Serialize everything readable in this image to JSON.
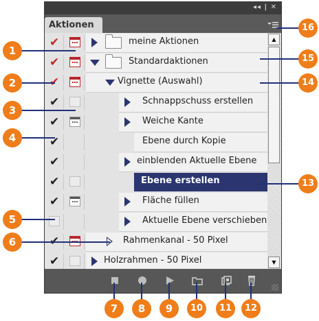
{
  "window": {
    "controls": "◂◂ | ✕",
    "tab_label": "Aktionen",
    "menu_icon": "panel-menu-icon"
  },
  "rows": [
    {
      "check": "red",
      "dialog": "red",
      "label": "meine Aktionen",
      "kind": "set",
      "expanded": false
    },
    {
      "check": "red",
      "dialog": "red",
      "label": "Standardaktionen",
      "kind": "set",
      "expanded": true
    },
    {
      "check": "red",
      "dialog": "red",
      "label": "Vignette (Auswahl)",
      "kind": "action",
      "expanded": true
    },
    {
      "check": "black",
      "dialog": "empty",
      "label": "Schnappschuss erstellen",
      "kind": "command",
      "expanded": false
    },
    {
      "check": "black",
      "dialog": "dark",
      "label": "Weiche Kante",
      "kind": "command",
      "expanded": false
    },
    {
      "check": "black",
      "dialog": "none",
      "label": "Ebene durch Kopie",
      "kind": "command-plain"
    },
    {
      "check": "black",
      "dialog": "none",
      "label": "einblenden Aktuelle Ebene",
      "kind": "command",
      "expanded": false
    },
    {
      "check": "black",
      "dialog": "empty",
      "label": "Ebene erstellen",
      "kind": "command-plain",
      "selected": true
    },
    {
      "check": "black",
      "dialog": "dark",
      "label": "Fläche füllen",
      "kind": "command",
      "expanded": false
    },
    {
      "check": "none",
      "dialog": "none",
      "label": "Aktuelle Ebene verschieben",
      "kind": "command",
      "expanded": false
    },
    {
      "check": "black",
      "dialog": "red",
      "label": "Rahmenkanal - 50 Pixel",
      "kind": "action",
      "expanded": false
    },
    {
      "check": "black",
      "dialog": "empty",
      "label": "Holzrahmen - 50 Pixel",
      "kind": "action",
      "expanded": false
    }
  ],
  "toolbar": [
    "stop-icon",
    "record-icon",
    "play-icon",
    "new-set-icon",
    "new-action-icon",
    "delete-icon"
  ],
  "callouts": [
    "1",
    "2",
    "3",
    "4",
    "5",
    "6",
    "7",
    "8",
    "9",
    "10",
    "11",
    "12",
    "13",
    "14",
    "15",
    "16"
  ],
  "colors": {
    "accent": "#ef7d1a",
    "selection": "#2b3670",
    "check_red": "#c1272d",
    "panel": "#4e4e4e"
  }
}
